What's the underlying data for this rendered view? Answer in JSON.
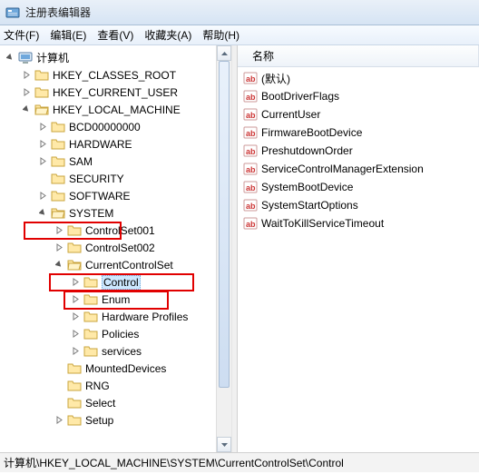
{
  "window": {
    "title": "注册表编辑器"
  },
  "menu": {
    "file": "文件(F)",
    "edit": "编辑(E)",
    "view": "查看(V)",
    "fav": "收藏夹(A)",
    "help": "帮助(H)"
  },
  "tree": {
    "root": "计算机",
    "hkcr": "HKEY_CLASSES_ROOT",
    "hkcu": "HKEY_CURRENT_USER",
    "hklm": "HKEY_LOCAL_MACHINE",
    "hklm_children": {
      "bcd": "BCD00000000",
      "hardware": "HARDWARE",
      "sam": "SAM",
      "security": "SECURITY",
      "software": "SOFTWARE",
      "system": "SYSTEM"
    },
    "system_children": {
      "cs001": "ControlSet001",
      "cs002": "ControlSet002",
      "ccs": "CurrentControlSet",
      "mounted": "MountedDevices",
      "rng": "RNG",
      "select": "Select",
      "setup": "Setup"
    },
    "ccs_children": {
      "control": "Control",
      "enum": "Enum",
      "hwprofiles": "Hardware Profiles",
      "policies": "Policies",
      "services": "services"
    }
  },
  "list": {
    "header_name": "名称",
    "items": [
      "(默认)",
      "BootDriverFlags",
      "CurrentUser",
      "FirmwareBootDevice",
      "PreshutdownOrder",
      "ServiceControlManagerExtension",
      "SystemBootDevice",
      "SystemStartOptions",
      "WaitToKillServiceTimeout"
    ]
  },
  "status": {
    "path": "计算机\\HKEY_LOCAL_MACHINE\\SYSTEM\\CurrentControlSet\\Control"
  },
  "colors": {
    "highlight": "#e10000",
    "selection": "#cde8ff"
  }
}
